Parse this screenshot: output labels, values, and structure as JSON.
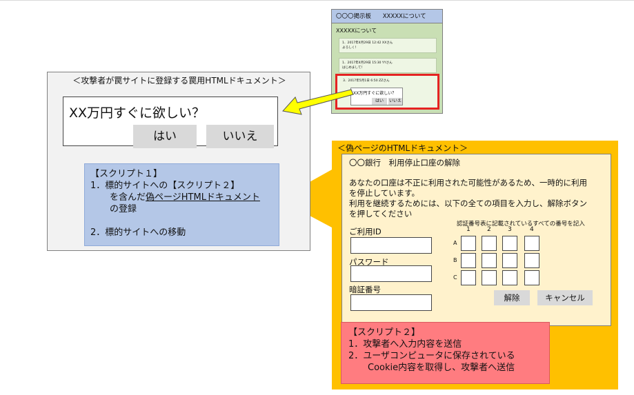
{
  "bbs": {
    "header_title": "〇〇〇掲示板",
    "header_thread": "XXXXXについて",
    "thread_title": "XXXXXについて",
    "posts": [
      {
        "meta": "1．2017年4月29日 12:42  XXさん",
        "body": "よろしく！"
      },
      {
        "meta": "1．2017年4月29日 15:30  YYさん",
        "body": "はじめまして！"
      }
    ],
    "malicious_post_meta": "3．2017年5月1日 6:50  ZZさん",
    "mini_ad_question": "XX万円すぐに欲しい？",
    "mini_yes": "はい",
    "mini_no": "いいえ"
  },
  "left_panel": {
    "title": "＜攻撃者が罠サイトに登録する罠用HTMLドキュメント＞",
    "ad_question": "XX万円すぐに欲しい？",
    "yes_button": "はい",
    "no_button": "いいえ"
  },
  "script1": {
    "heading": "【スクリプト１】",
    "line1": "1．標的サイトへの【スクリプト２】",
    "line2a": "を含んだ",
    "line2b": "偽ページHTMLドキュメント",
    "line3": "の登録",
    "line4": "2．標的サイトへの移動"
  },
  "fake_page": {
    "title": "＜偽ページのHTMLドキュメント＞",
    "bank_title": "〇〇銀行　利用停止口座の解除",
    "msg1": "あなたの口座は不正に利用された可能性があるため、一時的に利用",
    "msg2": "を停止しています。",
    "msg3": "利用を継続するためには、以下の全ての項目を入力し、解除ボタン",
    "msg4": "を押してください",
    "user_id_label": "ご利用ID",
    "password_label": "パスワード",
    "pin_label": "暗証番号",
    "grid_caption": "認証番号表に記載されているすべての番号を記入",
    "cols": [
      "1",
      "2",
      "3",
      "4"
    ],
    "rows": [
      "A",
      "B",
      "C"
    ],
    "unlock_button": "解除",
    "cancel_button": "キャンセル"
  },
  "script2": {
    "heading": "【スクリプト２】",
    "line1": "1．攻撃者へ入力内容を送信",
    "line2": "2．ユーザコンピュータに保存されている",
    "line3": "Cookie内容を取得し、攻撃者へ送信"
  },
  "colors": {
    "blue_callout": "#b4c7e7",
    "orange_page": "#ffc000",
    "red_callout": "#ff7c80",
    "arrow": "#ffff00",
    "highlight_red": "#e52222"
  }
}
